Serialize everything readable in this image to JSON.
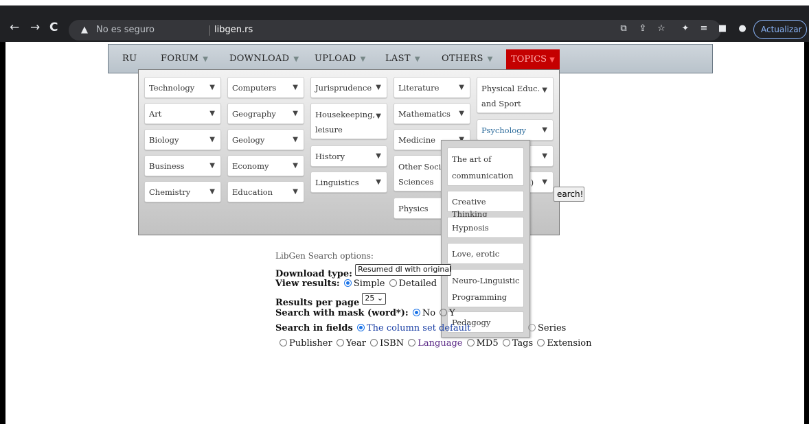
{
  "browser": {
    "back_icon": "←",
    "forward_icon": "→",
    "reload_icon": "C",
    "warning_icon": "▲",
    "security_text": "No es seguro",
    "host": "libgen.rs",
    "update_label": "Actualizar"
  },
  "menu": {
    "ru": "RU",
    "forum": "FORUM",
    "download": "DOWNLOAD",
    "upload": "UPLOAD",
    "last": "LAST",
    "others": "OTHERS",
    "topics": "TOPICS",
    "caret": "▼"
  },
  "topics": {
    "col1": [
      "Technology",
      "Art",
      "Biology",
      "Business",
      "Chemistry"
    ],
    "col2": [
      "Computers",
      "Geography",
      "Geology",
      "Economy",
      "Education"
    ],
    "col3": [
      "Jurisprudence",
      "Housekeeping,",
      "leisure",
      "History",
      "Linguistics"
    ],
    "col4": [
      "Literature",
      "Mathematics",
      "Medicine",
      "Other Social",
      "Sciences",
      "Physics"
    ],
    "col5": [
      "Physical Educ.",
      "and Sport",
      "Psychology",
      "l)"
    ],
    "arrow": "▼"
  },
  "psychology_submenu": [
    "The art of",
    "communication",
    "Creative Thinking",
    "Hypnosis",
    "Love, erotic",
    "Neuro-Linguistic",
    "Programming",
    "Pedagogy"
  ],
  "search_button_visible": "earch!",
  "options": {
    "heading": "LibGen Search options:",
    "download_type_label": "Download type:",
    "download_type_value": "Resumed dl with original fi",
    "view_results_label": "View results:",
    "simple": "Simple",
    "detailed": "Detailed",
    "results_per_page_label": "Results per page",
    "results_per_page_value": "25",
    "mask_label": "Search with mask (word*):",
    "mask_no": "No",
    "mask_yes_partial": "Y",
    "fields_label": "Search in fields",
    "fields_default": "The column set default",
    "series": "Series",
    "publisher": "Publisher",
    "year": "Year",
    "isbn": "ISBN",
    "language": "Language",
    "md5": "MD5",
    "tags": "Tags",
    "extension": "Extension"
  }
}
